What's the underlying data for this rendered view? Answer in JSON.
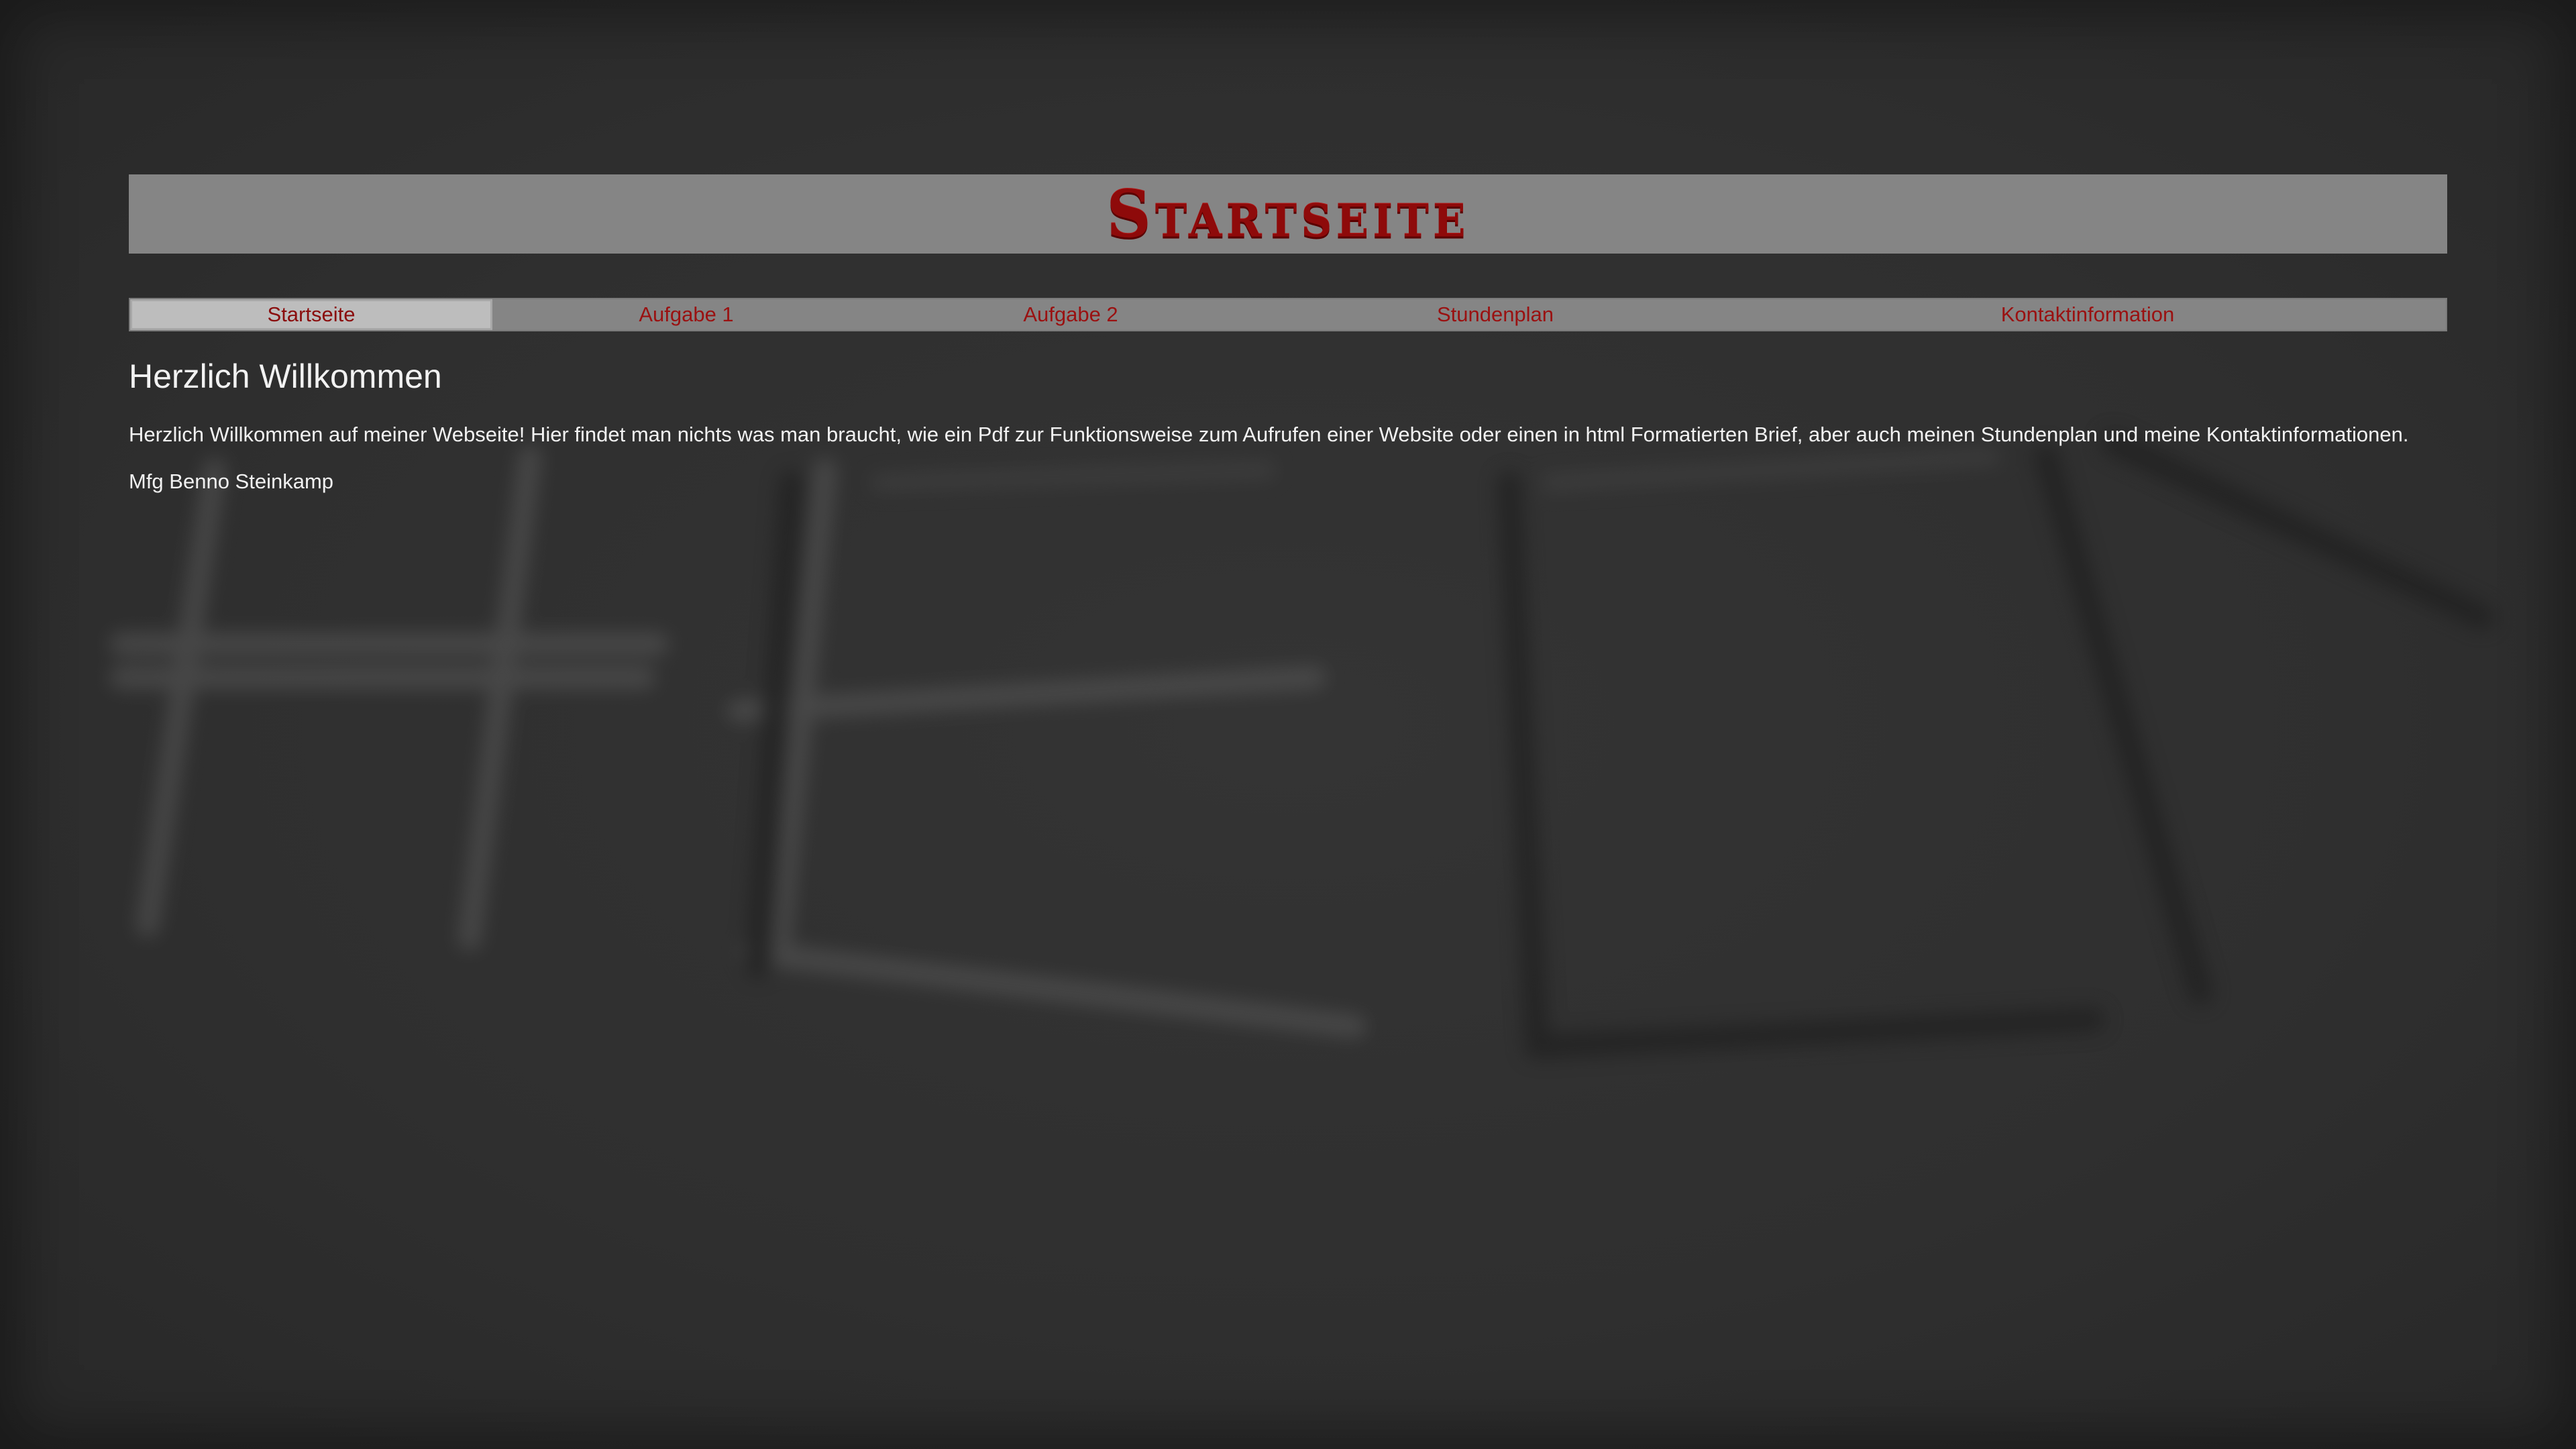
{
  "header": {
    "title": "Startseite"
  },
  "nav": {
    "items": [
      {
        "label": "Startseite",
        "active": true
      },
      {
        "label": "Aufgabe 1",
        "active": false
      },
      {
        "label": "Aufgabe 2",
        "active": false
      },
      {
        "label": "Stundenplan",
        "active": false
      },
      {
        "label": "Kontaktinformation",
        "active": false
      }
    ]
  },
  "main": {
    "heading": "Herzlich Willkommen",
    "intro": "Herzlich Willkommen auf meiner Webseite! Hier findet man nichts was man braucht, wie ein Pdf zur Funktionsweise zum Aufrufen einer Website oder einen in html Formatierten Brief, aber auch meinen Stundenplan und meine Kontaktinformationen.",
    "signature": "Mfg Benno Steinkamp"
  },
  "colors": {
    "background": "#2e2e2e",
    "banner": "#858585",
    "accent": "#8e0a0a",
    "nav_active": "#bdbdbd",
    "text": "#f2f2f2"
  }
}
